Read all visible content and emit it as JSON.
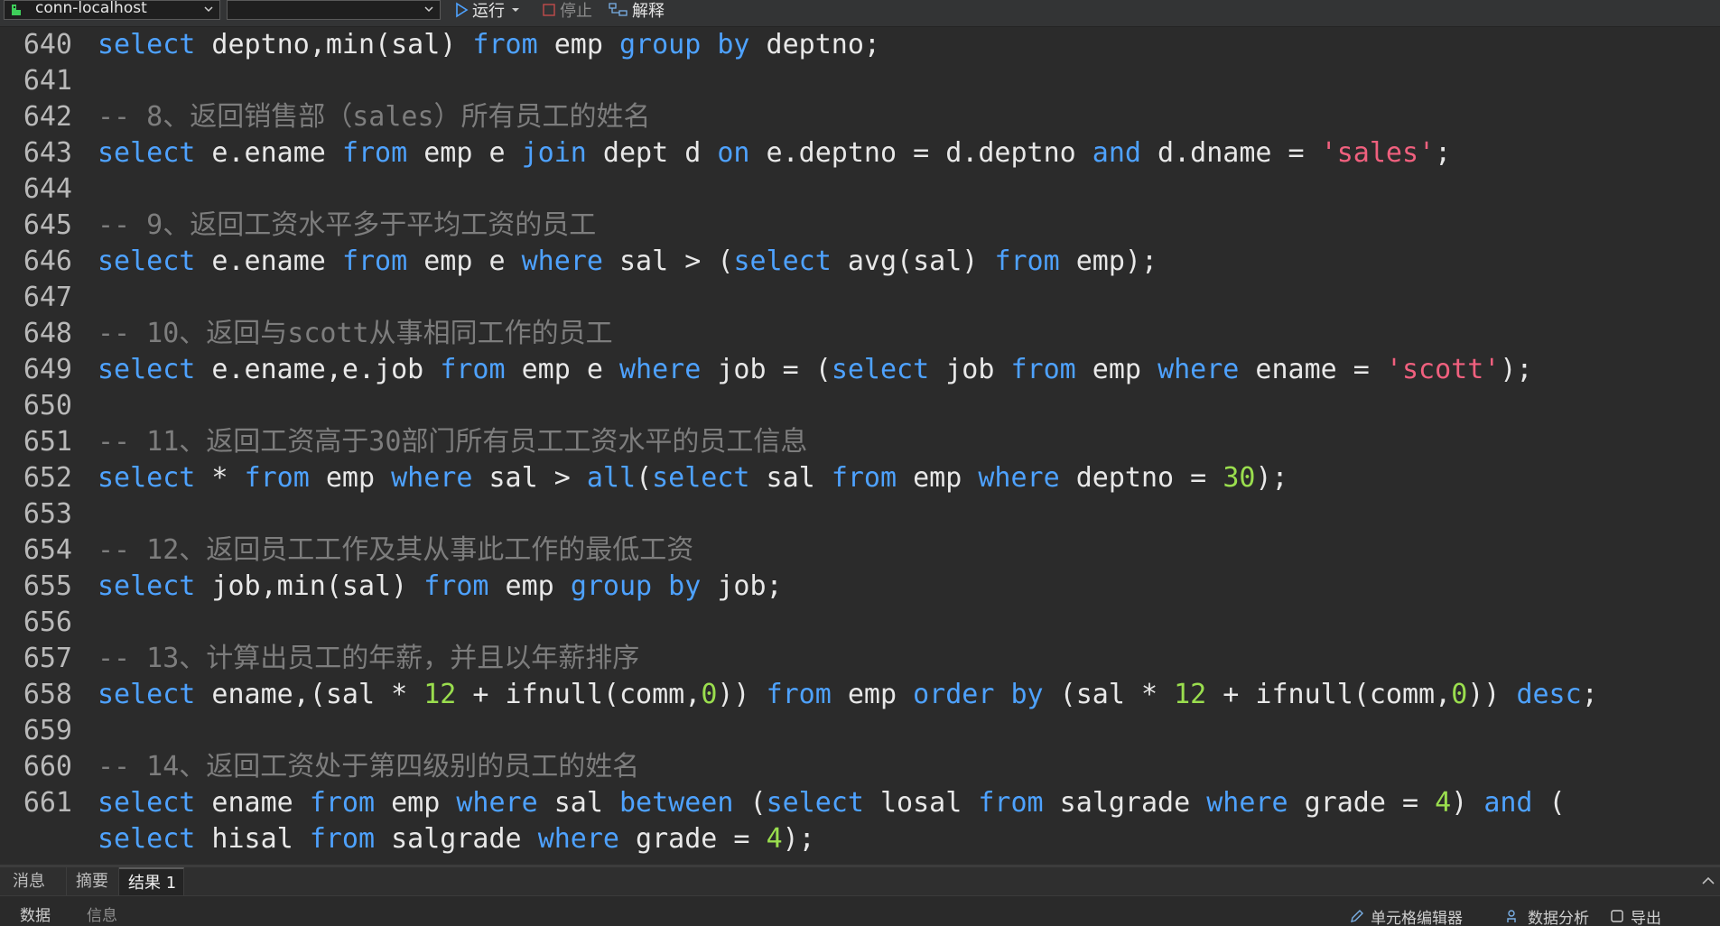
{
  "toolbar": {
    "connection": "conn-localhost",
    "database": "",
    "run": "运行",
    "stop": "停止",
    "explain": "解释"
  },
  "editor": {
    "lines": [
      {
        "n": "640",
        "tokens": [
          {
            "t": "select",
            "c": "kw"
          },
          {
            "t": " deptno,min(sal) ",
            "c": ""
          },
          {
            "t": "from",
            "c": "kw"
          },
          {
            "t": " emp ",
            "c": ""
          },
          {
            "t": "group by",
            "c": "kw"
          },
          {
            "t": " deptno;",
            "c": ""
          }
        ]
      },
      {
        "n": "641",
        "tokens": []
      },
      {
        "n": "642",
        "tokens": [
          {
            "t": "-- 8、返回销售部（sales）所有员工的姓名",
            "c": "cm"
          }
        ]
      },
      {
        "n": "643",
        "tokens": [
          {
            "t": "select",
            "c": "kw"
          },
          {
            "t": " e.ename ",
            "c": ""
          },
          {
            "t": "from",
            "c": "kw"
          },
          {
            "t": " emp e ",
            "c": ""
          },
          {
            "t": "join",
            "c": "kw"
          },
          {
            "t": " dept d ",
            "c": ""
          },
          {
            "t": "on",
            "c": "kw"
          },
          {
            "t": " e.deptno = d.deptno ",
            "c": ""
          },
          {
            "t": "and",
            "c": "kw"
          },
          {
            "t": " d.dname = ",
            "c": ""
          },
          {
            "t": "'sales'",
            "c": "str"
          },
          {
            "t": ";",
            "c": ""
          }
        ]
      },
      {
        "n": "644",
        "tokens": []
      },
      {
        "n": "645",
        "tokens": [
          {
            "t": "-- 9、返回工资水平多于平均工资的员工",
            "c": "cm"
          }
        ]
      },
      {
        "n": "646",
        "tokens": [
          {
            "t": "select",
            "c": "kw"
          },
          {
            "t": " e.ename ",
            "c": ""
          },
          {
            "t": "from",
            "c": "kw"
          },
          {
            "t": " emp e ",
            "c": ""
          },
          {
            "t": "where",
            "c": "kw"
          },
          {
            "t": " sal > (",
            "c": ""
          },
          {
            "t": "select",
            "c": "kw"
          },
          {
            "t": " avg(sal) ",
            "c": ""
          },
          {
            "t": "from",
            "c": "kw"
          },
          {
            "t": " emp);",
            "c": ""
          }
        ]
      },
      {
        "n": "647",
        "tokens": []
      },
      {
        "n": "648",
        "tokens": [
          {
            "t": "-- 10、返回与scott从事相同工作的员工",
            "c": "cm"
          }
        ]
      },
      {
        "n": "649",
        "tokens": [
          {
            "t": "select",
            "c": "kw"
          },
          {
            "t": " e.ename,e.job ",
            "c": ""
          },
          {
            "t": "from",
            "c": "kw"
          },
          {
            "t": " emp e ",
            "c": ""
          },
          {
            "t": "where",
            "c": "kw"
          },
          {
            "t": " job = (",
            "c": ""
          },
          {
            "t": "select",
            "c": "kw"
          },
          {
            "t": " job ",
            "c": ""
          },
          {
            "t": "from",
            "c": "kw"
          },
          {
            "t": " emp ",
            "c": ""
          },
          {
            "t": "where",
            "c": "kw"
          },
          {
            "t": " ename = ",
            "c": ""
          },
          {
            "t": "'scott'",
            "c": "str"
          },
          {
            "t": ");",
            "c": ""
          }
        ]
      },
      {
        "n": "650",
        "tokens": []
      },
      {
        "n": "651",
        "tokens": [
          {
            "t": "-- 11、返回工资高于30部门所有员工工资水平的员工信息",
            "c": "cm"
          }
        ]
      },
      {
        "n": "652",
        "tokens": [
          {
            "t": "select",
            "c": "kw"
          },
          {
            "t": " * ",
            "c": ""
          },
          {
            "t": "from",
            "c": "kw"
          },
          {
            "t": " emp ",
            "c": ""
          },
          {
            "t": "where",
            "c": "kw"
          },
          {
            "t": " sal > ",
            "c": ""
          },
          {
            "t": "all",
            "c": "kw"
          },
          {
            "t": "(",
            "c": ""
          },
          {
            "t": "select",
            "c": "kw"
          },
          {
            "t": " sal ",
            "c": ""
          },
          {
            "t": "from",
            "c": "kw"
          },
          {
            "t": " emp ",
            "c": ""
          },
          {
            "t": "where",
            "c": "kw"
          },
          {
            "t": " deptno = ",
            "c": ""
          },
          {
            "t": "30",
            "c": "num"
          },
          {
            "t": ");",
            "c": ""
          }
        ]
      },
      {
        "n": "653",
        "tokens": []
      },
      {
        "n": "654",
        "tokens": [
          {
            "t": "-- 12、返回员工工作及其从事此工作的最低工资",
            "c": "cm"
          }
        ]
      },
      {
        "n": "655",
        "tokens": [
          {
            "t": "select",
            "c": "kw"
          },
          {
            "t": " job,min(sal) ",
            "c": ""
          },
          {
            "t": "from",
            "c": "kw"
          },
          {
            "t": " emp ",
            "c": ""
          },
          {
            "t": "group by",
            "c": "kw"
          },
          {
            "t": " job;",
            "c": ""
          }
        ]
      },
      {
        "n": "656",
        "tokens": []
      },
      {
        "n": "657",
        "tokens": [
          {
            "t": "-- 13、计算出员工的年薪，并且以年薪排序",
            "c": "cm"
          }
        ]
      },
      {
        "n": "658",
        "tokens": [
          {
            "t": "select",
            "c": "kw"
          },
          {
            "t": " ename,(sal * ",
            "c": ""
          },
          {
            "t": "12",
            "c": "num"
          },
          {
            "t": " + ifnull(comm,",
            "c": ""
          },
          {
            "t": "0",
            "c": "num"
          },
          {
            "t": ")) ",
            "c": ""
          },
          {
            "t": "from",
            "c": "kw"
          },
          {
            "t": " emp ",
            "c": ""
          },
          {
            "t": "order by",
            "c": "kw"
          },
          {
            "t": " (sal * ",
            "c": ""
          },
          {
            "t": "12",
            "c": "num"
          },
          {
            "t": " + ifnull(comm,",
            "c": ""
          },
          {
            "t": "0",
            "c": "num"
          },
          {
            "t": ")) ",
            "c": ""
          },
          {
            "t": "desc",
            "c": "kw"
          },
          {
            "t": ";",
            "c": ""
          }
        ]
      },
      {
        "n": "659",
        "tokens": []
      },
      {
        "n": "660",
        "tokens": [
          {
            "t": "-- 14、返回工资处于第四级别的员工的姓名",
            "c": "cm"
          }
        ]
      },
      {
        "n": "661",
        "tokens": [
          {
            "t": "select",
            "c": "kw"
          },
          {
            "t": " ename ",
            "c": ""
          },
          {
            "t": "from",
            "c": "kw"
          },
          {
            "t": " emp ",
            "c": ""
          },
          {
            "t": "where",
            "c": "kw"
          },
          {
            "t": " sal ",
            "c": ""
          },
          {
            "t": "between",
            "c": "kw"
          },
          {
            "t": " (",
            "c": ""
          },
          {
            "t": "select",
            "c": "kw"
          },
          {
            "t": " losal ",
            "c": ""
          },
          {
            "t": "from",
            "c": "kw"
          },
          {
            "t": " salgrade ",
            "c": ""
          },
          {
            "t": "where",
            "c": "kw"
          },
          {
            "t": " grade = ",
            "c": ""
          },
          {
            "t": "4",
            "c": "num"
          },
          {
            "t": ") ",
            "c": ""
          },
          {
            "t": "and",
            "c": "kw"
          },
          {
            "t": " (",
            "c": ""
          }
        ]
      },
      {
        "n": "",
        "tokens": [
          {
            "t": "select",
            "c": "kw"
          },
          {
            "t": " hisal ",
            "c": ""
          },
          {
            "t": "from",
            "c": "kw"
          },
          {
            "t": " salgrade ",
            "c": ""
          },
          {
            "t": "where",
            "c": "kw"
          },
          {
            "t": " grade = ",
            "c": ""
          },
          {
            "t": "4",
            "c": "num"
          },
          {
            "t": ");",
            "c": ""
          }
        ]
      }
    ]
  },
  "bottom": {
    "tabs": [
      "消息",
      "摘要",
      "结果 1"
    ],
    "sub_data": "数据",
    "sub_info": "信息",
    "cell_editor": "单元格编辑器",
    "data_analysis": "数据分析",
    "export": "导出"
  },
  "colors": {
    "background": "#2b2b2b",
    "keyword": "#4ea2ff",
    "comment": "#7d7d7d",
    "string": "#f0607e",
    "number": "#9ade4e"
  }
}
